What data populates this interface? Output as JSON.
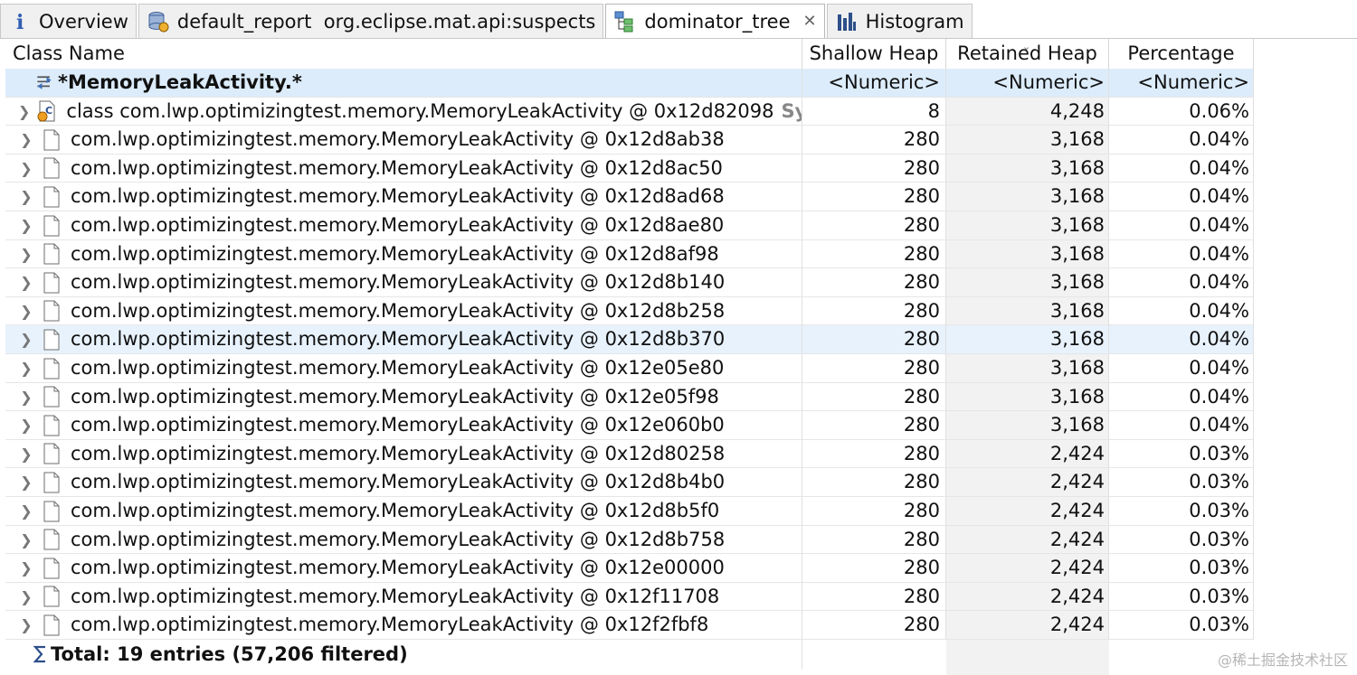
{
  "tabs": [
    {
      "label": "Overview",
      "icon": "info-icon",
      "active": false
    },
    {
      "label": "default_report  org.eclipse.mat.api:suspects",
      "icon": "report-icon",
      "active": false
    },
    {
      "label": "dominator_tree",
      "icon": "tree-icon",
      "active": true,
      "closable": true
    },
    {
      "label": "Histogram",
      "icon": "histogram-icon",
      "active": false
    }
  ],
  "columns": {
    "class_name": "Class Name",
    "shallow_heap": "Shallow Heap",
    "retained_heap": "Retained Heap",
    "percentage": "Percentage"
  },
  "filter_row": {
    "pattern": "*MemoryLeakActivity.*",
    "shallow": "<Numeric>",
    "retained": "<Numeric>",
    "percentage": "<Numeric>"
  },
  "rows": [
    {
      "name": "class com.lwp.optimizingtest.memory.MemoryLeakActivity @ 0x12d82098",
      "suffix": "System",
      "type": "class",
      "shallow": "8",
      "retained": "4,248",
      "percentage": "0.06%"
    },
    {
      "name": "com.lwp.optimizingtest.memory.MemoryLeakActivity @ 0x12d8ab38",
      "type": "object",
      "shallow": "280",
      "retained": "3,168",
      "percentage": "0.04%"
    },
    {
      "name": "com.lwp.optimizingtest.memory.MemoryLeakActivity @ 0x12d8ac50",
      "type": "object",
      "shallow": "280",
      "retained": "3,168",
      "percentage": "0.04%"
    },
    {
      "name": "com.lwp.optimizingtest.memory.MemoryLeakActivity @ 0x12d8ad68",
      "type": "object",
      "shallow": "280",
      "retained": "3,168",
      "percentage": "0.04%"
    },
    {
      "name": "com.lwp.optimizingtest.memory.MemoryLeakActivity @ 0x12d8ae80",
      "type": "object",
      "shallow": "280",
      "retained": "3,168",
      "percentage": "0.04%"
    },
    {
      "name": "com.lwp.optimizingtest.memory.MemoryLeakActivity @ 0x12d8af98",
      "type": "object",
      "shallow": "280",
      "retained": "3,168",
      "percentage": "0.04%"
    },
    {
      "name": "com.lwp.optimizingtest.memory.MemoryLeakActivity @ 0x12d8b140",
      "type": "object",
      "shallow": "280",
      "retained": "3,168",
      "percentage": "0.04%"
    },
    {
      "name": "com.lwp.optimizingtest.memory.MemoryLeakActivity @ 0x12d8b258",
      "type": "object",
      "shallow": "280",
      "retained": "3,168",
      "percentage": "0.04%"
    },
    {
      "name": "com.lwp.optimizingtest.memory.MemoryLeakActivity @ 0x12d8b370",
      "type": "object",
      "shallow": "280",
      "retained": "3,168",
      "percentage": "0.04%",
      "selected": true
    },
    {
      "name": "com.lwp.optimizingtest.memory.MemoryLeakActivity @ 0x12e05e80",
      "type": "object",
      "shallow": "280",
      "retained": "3,168",
      "percentage": "0.04%"
    },
    {
      "name": "com.lwp.optimizingtest.memory.MemoryLeakActivity @ 0x12e05f98",
      "type": "object",
      "shallow": "280",
      "retained": "3,168",
      "percentage": "0.04%"
    },
    {
      "name": "com.lwp.optimizingtest.memory.MemoryLeakActivity @ 0x12e060b0",
      "type": "object",
      "shallow": "280",
      "retained": "3,168",
      "percentage": "0.04%"
    },
    {
      "name": "com.lwp.optimizingtest.memory.MemoryLeakActivity @ 0x12d80258",
      "type": "object",
      "shallow": "280",
      "retained": "2,424",
      "percentage": "0.03%"
    },
    {
      "name": "com.lwp.optimizingtest.memory.MemoryLeakActivity @ 0x12d8b4b0",
      "type": "object",
      "shallow": "280",
      "retained": "2,424",
      "percentage": "0.03%"
    },
    {
      "name": "com.lwp.optimizingtest.memory.MemoryLeakActivity @ 0x12d8b5f0",
      "type": "object",
      "shallow": "280",
      "retained": "2,424",
      "percentage": "0.03%"
    },
    {
      "name": "com.lwp.optimizingtest.memory.MemoryLeakActivity @ 0x12d8b758",
      "type": "object",
      "shallow": "280",
      "retained": "2,424",
      "percentage": "0.03%"
    },
    {
      "name": "com.lwp.optimizingtest.memory.MemoryLeakActivity @ 0x12e00000",
      "type": "object",
      "shallow": "280",
      "retained": "2,424",
      "percentage": "0.03%"
    },
    {
      "name": "com.lwp.optimizingtest.memory.MemoryLeakActivity @ 0x12f11708",
      "type": "object",
      "shallow": "280",
      "retained": "2,424",
      "percentage": "0.03%"
    },
    {
      "name": "com.lwp.optimizingtest.memory.MemoryLeakActivity @ 0x12f2fbf8",
      "type": "object",
      "shallow": "280",
      "retained": "2,424",
      "percentage": "0.03%"
    }
  ],
  "total": "Total: 19 entries (57,206 filtered)",
  "watermark": "@稀土掘金技术社区",
  "colors": {
    "filter_row_bg": "#dcecfb",
    "selected_row_bg": "#e8f2fd",
    "retained_col_bg": "#f2f2f2"
  }
}
